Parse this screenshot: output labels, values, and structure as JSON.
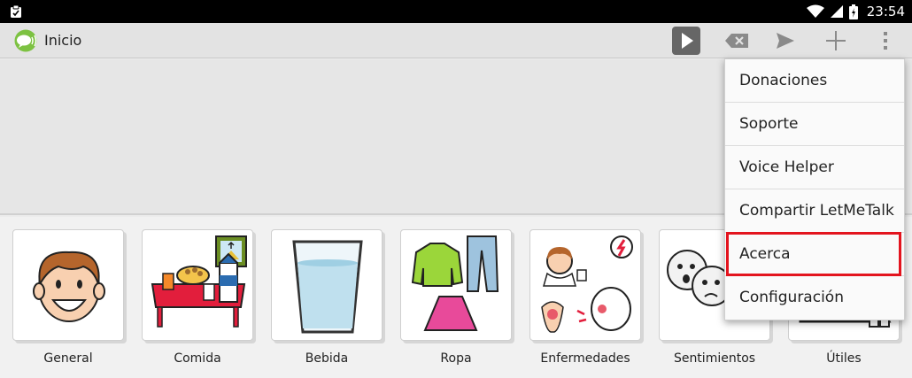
{
  "status_bar": {
    "time": "23:54",
    "icons": [
      "clipboard-icon",
      "wifi-icon",
      "signal-icon",
      "battery-icon"
    ]
  },
  "action_bar": {
    "title": "Inicio",
    "icons": [
      "play-icon",
      "backspace-icon",
      "send-icon",
      "add-icon",
      "more-icon"
    ]
  },
  "menu": {
    "items": [
      {
        "label": "Donaciones"
      },
      {
        "label": "Soporte"
      },
      {
        "label": "Voice Helper"
      },
      {
        "label": "Compartir LetMeTalk"
      },
      {
        "label": "Acerca",
        "highlighted": true
      },
      {
        "label": "Configuración"
      }
    ]
  },
  "categories": [
    {
      "label": "General",
      "icon": "smiling-boy-icon"
    },
    {
      "label": "Comida",
      "icon": "food-table-icon"
    },
    {
      "label": "Bebida",
      "icon": "water-glass-icon"
    },
    {
      "label": "Ropa",
      "icon": "clothes-icon"
    },
    {
      "label": "Enfermedades",
      "icon": "illness-icon"
    },
    {
      "label": "Sentimientos",
      "icon": "feelings-faces-icon"
    },
    {
      "label": "Útiles",
      "icon": "tools-icon"
    }
  ],
  "colors": {
    "accent_highlight": "#e3141e",
    "logo_green": "#7dc242",
    "status_bar": "#000000",
    "action_bar": "#e3e3e3"
  }
}
